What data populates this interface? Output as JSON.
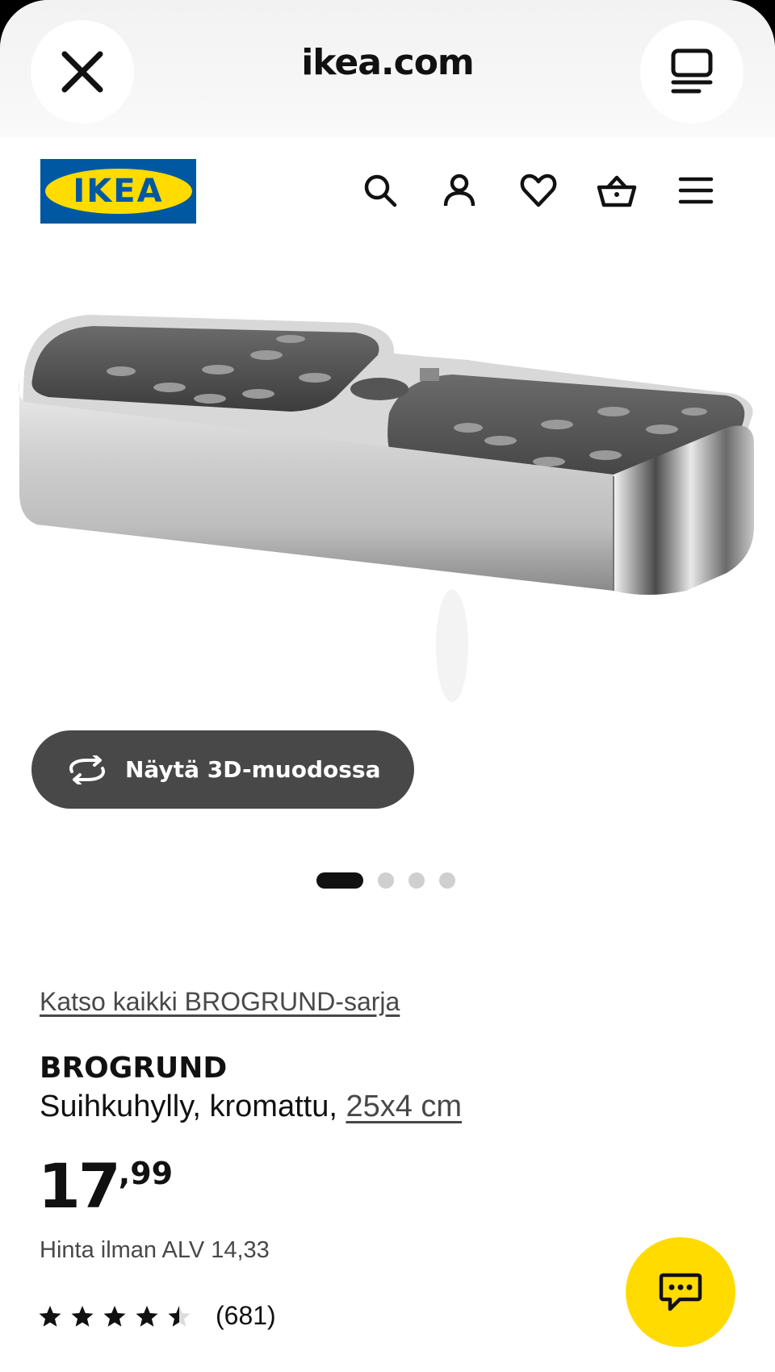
{
  "browser": {
    "url": "ikea.com",
    "close_icon": "close-icon",
    "tabs_icon": "tabs-icon"
  },
  "header": {
    "logo_text": "IKEA",
    "icons": [
      "search-icon",
      "account-icon",
      "heart-icon",
      "basket-icon",
      "menu-icon"
    ],
    "colors": {
      "brand_blue": "#0058a3",
      "brand_yellow": "#ffdb00"
    }
  },
  "gallery": {
    "view_3d_label": "Näytä 3D-muodossa",
    "view_3d_icon": "rotate-icon",
    "current_slide": 1,
    "total_slides": 4
  },
  "product": {
    "series_link": "Katso kaikki BROGRUND-sarja",
    "name": "BROGRUND",
    "description": "Suihkuhylly, kromattu, ",
    "dimensions": "25x4 cm",
    "price_integer": "17",
    "price_decimal": ",99",
    "price_ex_vat": "Hinta ilman ALV 14,33",
    "rating": 4.5,
    "rating_max": 5,
    "review_count": "(681)"
  },
  "chat": {
    "icon": "chat-icon",
    "color": "#ffdb00"
  }
}
